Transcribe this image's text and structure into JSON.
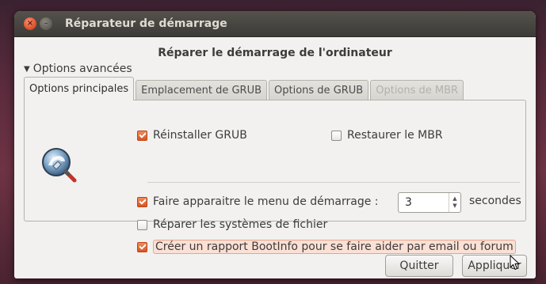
{
  "window": {
    "title": "Réparateur de démarrage",
    "close_glyph": "×",
    "minimize_glyph": "–"
  },
  "heading": "Réparer le démarrage de l'ordinateur",
  "expander": {
    "arrow": "▼",
    "label": "Options avancées"
  },
  "tabs": [
    {
      "label": "Options principales",
      "active": true,
      "enabled": true
    },
    {
      "label": "Emplacement de GRUB",
      "active": false,
      "enabled": true
    },
    {
      "label": "Options de GRUB",
      "active": false,
      "enabled": true
    },
    {
      "label": "Options de MBR",
      "active": false,
      "enabled": false
    }
  ],
  "options": {
    "reinstall_grub": {
      "label": "Réinstaller GRUB",
      "checked": true
    },
    "restore_mbr": {
      "label": "Restaurer le MBR",
      "checked": false
    },
    "show_boot_menu": {
      "label": "Faire apparaitre le menu de démarrage :",
      "checked": true
    },
    "repair_filesystems": {
      "label": "Réparer les systèmes de fichier",
      "checked": false
    },
    "bootinfo_report": {
      "label": "Créer un rapport BootInfo pour se faire aider par email ou forum",
      "checked": true
    }
  },
  "boot_menu_timeout": {
    "value": "3",
    "unit": "secondes",
    "up_glyph": "▲",
    "down_glyph": "▼"
  },
  "buttons": {
    "quit": "Quitter",
    "apply": "Appliquer"
  },
  "colors": {
    "accent": "#dd5a24",
    "titlebar": "#3c3b37",
    "window_bg": "#f2f1f0",
    "desktop": "#5a2b3c"
  },
  "icons": {
    "app": "boot-repair-magnifier-icon",
    "cursor": "mouse-pointer-icon"
  }
}
